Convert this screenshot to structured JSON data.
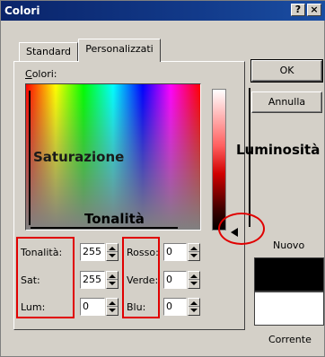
{
  "window": {
    "title": "Colori",
    "help_label": "?",
    "close_label": "×"
  },
  "tabs": [
    {
      "label": "Standard"
    },
    {
      "label": "Personalizzati"
    }
  ],
  "palette": {
    "label": "Colori:"
  },
  "fields": {
    "tonalita": {
      "label": "Tonalità:",
      "value": "255"
    },
    "sat": {
      "label": "Sat:",
      "value": "255"
    },
    "lum": {
      "label": "Lum:",
      "value": "0"
    },
    "rosso": {
      "label": "Rosso:",
      "value": "0"
    },
    "verde": {
      "label": "Verde:",
      "value": "0"
    },
    "blu": {
      "label": "Blu:",
      "value": "0"
    }
  },
  "annotations": {
    "saturazione": "Saturazione",
    "tonalita": "Tonalità",
    "luminosita": "Luminosità"
  },
  "buttons": {
    "ok": "OK",
    "annulla": "Annulla"
  },
  "preview": {
    "nuovo_label": "Nuovo",
    "corrente_label": "Corrente",
    "nuovo_color": "#000000",
    "corrente_color": "#ffffff"
  },
  "colors": {
    "annotation_red": "#e00000",
    "titlebar": "#0a246a"
  }
}
